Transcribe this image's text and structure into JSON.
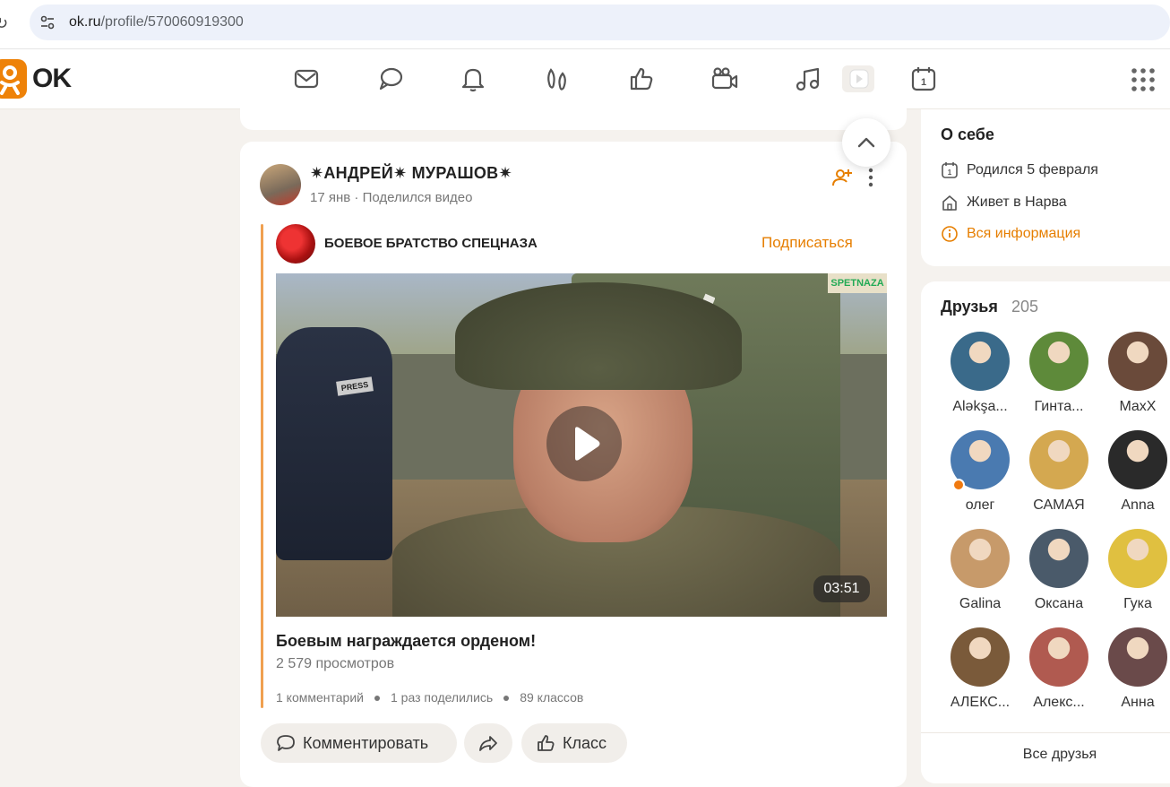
{
  "browser": {
    "url_host": "ok.ru",
    "url_path": "/profile/570060919300"
  },
  "header": {
    "logo_text": "OK",
    "nav_icons": [
      "mail-icon",
      "discussions-icon",
      "notifications-icon",
      "guests-icon",
      "likes-icon",
      "video-camera-icon",
      "music-icon",
      "video-play-icon",
      "calendar-icon",
      "apps-grid-icon"
    ],
    "brand_color": "#ee8208"
  },
  "post": {
    "author": "✷АНДРЕЙ✷ МУРАШОВ✷",
    "date": "17 янв",
    "action": "Поделился видео",
    "group_name": "БОЕВОЕ БРАТСТВО СПЕЦНАЗА",
    "subscribe_label": "Подписаться",
    "video": {
      "watermark": "SPETNAZA",
      "press_label": "PRESS",
      "duration": "03:51",
      "title": "Боевым награждается орденом!",
      "views": "2 579 просмотров"
    },
    "stats": {
      "comments": "1 комментарий",
      "shares": "1 раз поделились",
      "likes": "89 классов"
    },
    "buttons": {
      "comment": "Комментировать",
      "like": "Класс"
    }
  },
  "about": {
    "title": "О себе",
    "born": "Родился 5 февраля",
    "lives": "Живет в Нарва",
    "all_info": "Вся информация"
  },
  "friends": {
    "title": "Друзья",
    "count": "205",
    "items": [
      {
        "name": "Aləkşa...",
        "color": "#3a6a8a"
      },
      {
        "name": "Гинта...",
        "color": "#5e8a3a"
      },
      {
        "name": "MaxX",
        "color": "#6a4a3a"
      },
      {
        "name": "олег",
        "color": "#4a7ab0",
        "online": true
      },
      {
        "name": "САМАЯ",
        "color": "#d4a850"
      },
      {
        "name": "Anna",
        "color": "#2a2a2a"
      },
      {
        "name": "Galina",
        "color": "#c79a6a"
      },
      {
        "name": "Оксана",
        "color": "#4a5a6a"
      },
      {
        "name": "Гука",
        "color": "#e0c040"
      },
      {
        "name": "АЛЕКС...",
        "color": "#7a5a3a"
      },
      {
        "name": "Алекс...",
        "color": "#b05a50"
      },
      {
        "name": "Анна",
        "color": "#6a4a4a"
      }
    ],
    "all_label": "Все друзья"
  }
}
